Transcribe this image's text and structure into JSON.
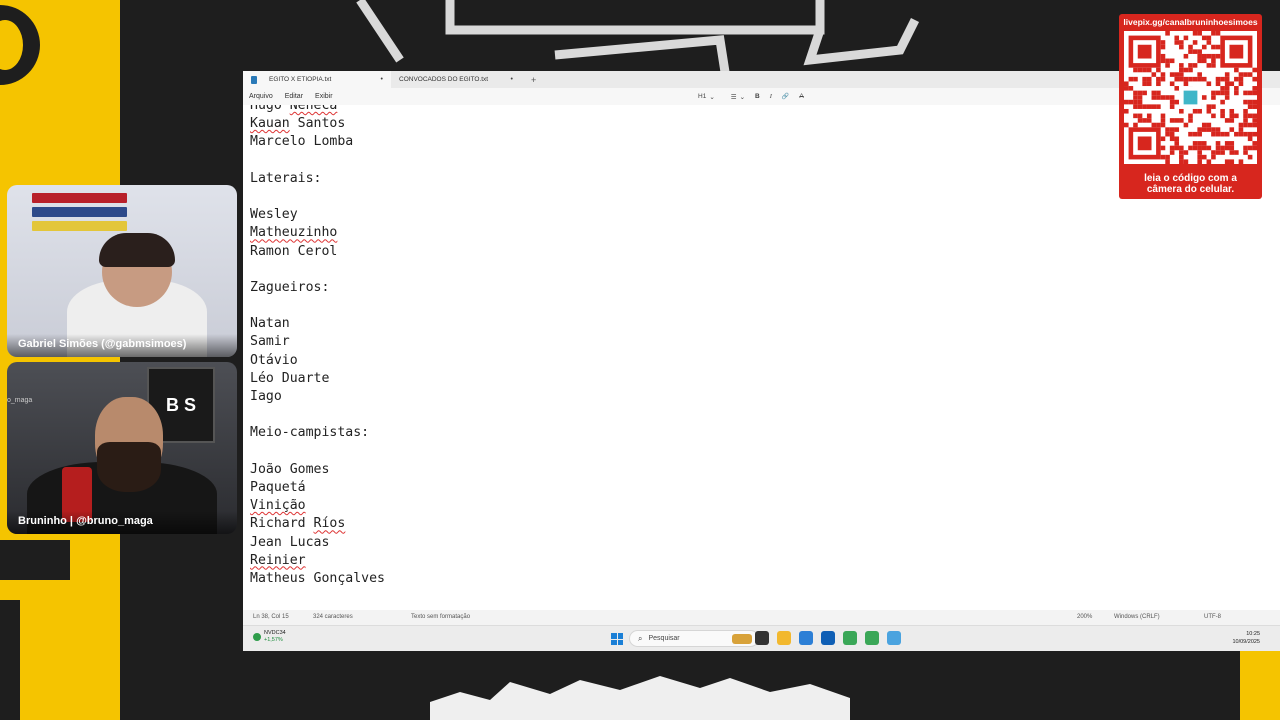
{
  "app": {
    "tabs": [
      {
        "label": "EGITO X ETIÓPIA.txt",
        "close": "•"
      },
      {
        "label": "CONVOCADOS DO EGITO.txt",
        "close": "•"
      }
    ],
    "new_tab": "+",
    "menu": [
      "Arquivo",
      "Editar",
      "Exibir"
    ],
    "toolbar": {
      "heading": "H1",
      "heading_caret": "⌄",
      "list_icon": "☰",
      "list_caret": "⌄",
      "bold": "B",
      "italic": "I",
      "link": "🔗",
      "format": "A"
    },
    "lines": [
      {
        "text": "Hugo Neneca",
        "spell": "Neneca"
      },
      {
        "text": "Kauan Santos",
        "spell": "Kauan"
      },
      {
        "text": "Marcelo Lomba"
      },
      {
        "text": ""
      },
      {
        "text": "Laterais:"
      },
      {
        "text": ""
      },
      {
        "text": "Wesley"
      },
      {
        "text": "Matheuzinho",
        "spell": "Matheuzinho"
      },
      {
        "text": "Ramon Cerol"
      },
      {
        "text": ""
      },
      {
        "text": "Zagueiros:"
      },
      {
        "text": ""
      },
      {
        "text": "Natan"
      },
      {
        "text": "Samir"
      },
      {
        "text": "Otávio"
      },
      {
        "text": "Léo Duarte"
      },
      {
        "text": "Iago"
      },
      {
        "text": ""
      },
      {
        "text": "Meio-campistas:"
      },
      {
        "text": ""
      },
      {
        "text": "João Gomes"
      },
      {
        "text": "Paquetá"
      },
      {
        "text": "Vinição",
        "spell": "Vinição"
      },
      {
        "text": "Richard Ríos",
        "spell": "Ríos"
      },
      {
        "text": "Jean Lucas"
      },
      {
        "text": "Reinier",
        "spell": "Reinier"
      },
      {
        "text": "Matheus Gonçalves"
      }
    ],
    "status": {
      "position": "Ln 38, Col 15",
      "chars": "324 caracteres",
      "format": "Texto sem formatação",
      "zoom": "200%",
      "line_ending": "Windows (CRLF)",
      "encoding": "UTF-8"
    }
  },
  "taskbar": {
    "stock_name": "NVDC34",
    "stock_change": "+1,57%",
    "search_placeholder": "Pesquisar",
    "time": "10:25",
    "date": "10/09/2025"
  },
  "cams": [
    {
      "label": "Gabriel Simões (@gabmsimoes)"
    },
    {
      "label": "Bruninho | @bruno_maga",
      "handle": "o_maga",
      "sign": "B S"
    }
  ],
  "qr": {
    "url": "livepix.gg/canalbruninhoesimoes",
    "caption_line1": "leia o código com a",
    "caption_line2": "câmera do celular."
  },
  "colors": {
    "brand_yellow": "#f5c400",
    "brand_red": "#d7261e",
    "spell_underline": "#dd3333"
  }
}
